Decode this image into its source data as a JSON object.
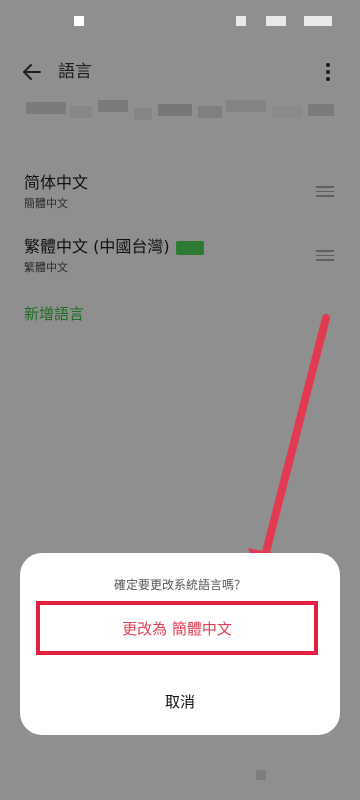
{
  "app_bar": {
    "title": "語言",
    "back_icon": "arrow-left-icon",
    "more_icon": "more-vertical-icon"
  },
  "languages": [
    {
      "name": "简体中文",
      "subtitle": "簡體中文"
    },
    {
      "name": "繁體中文 (中國台灣)",
      "subtitle": "繁體中文"
    }
  ],
  "add_language_label": "新增語言",
  "dialog": {
    "message": "確定要更改系統語言嗎？",
    "confirm_label": "更改為 簡體中文",
    "cancel_label": "取消"
  },
  "colors": {
    "scrim": "#8f8f8f",
    "accent_green": "#1f6e24",
    "highlight_red": "#e21f3f",
    "confirm_text": "#e04156",
    "dialog_bg": "#ffffff"
  }
}
